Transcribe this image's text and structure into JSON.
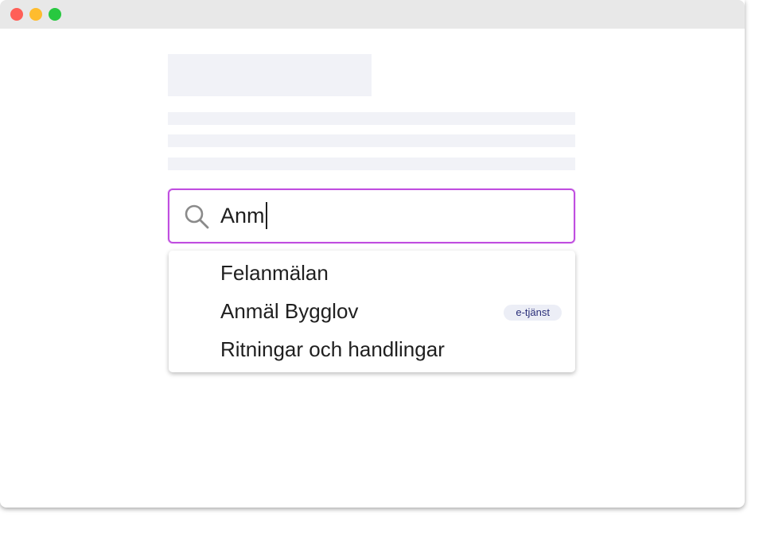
{
  "window": {
    "controls": {
      "close_color": "#ff5f57",
      "minimize_color": "#febc2e",
      "maximize_color": "#28c840"
    }
  },
  "search": {
    "value": "Anm",
    "icon": "search-icon",
    "border_color": "#c04ee0"
  },
  "suggestions": [
    {
      "label": "Felanmälan",
      "badge": null
    },
    {
      "label": "Anmäl Bygglov",
      "badge": "e-tjänst"
    },
    {
      "label": "Ritningar och handlingar",
      "badge": null
    }
  ]
}
